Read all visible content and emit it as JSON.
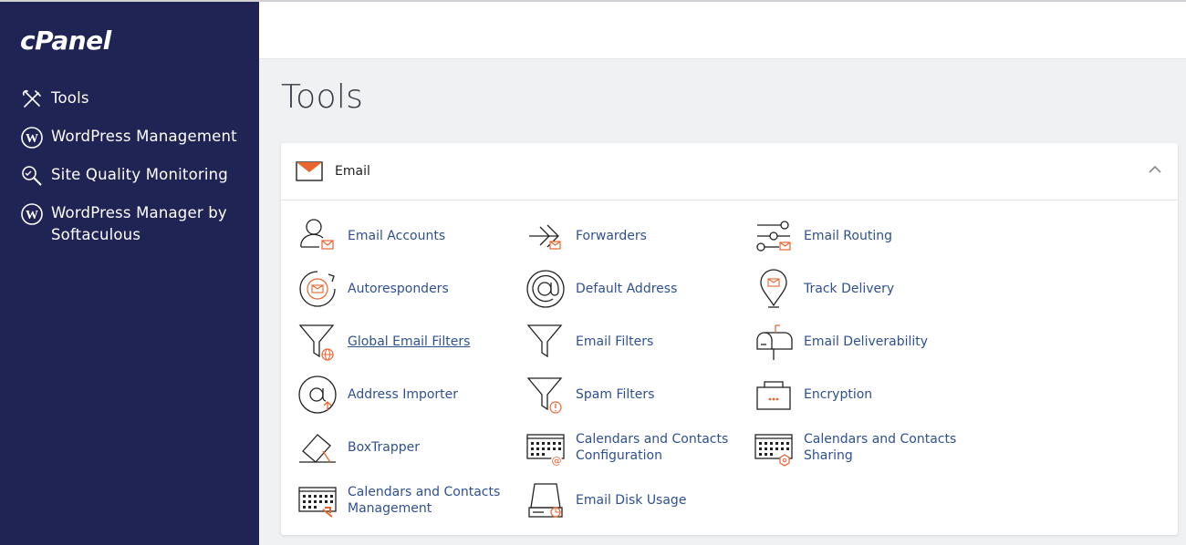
{
  "brand": {
    "logo_text": "cPanel"
  },
  "sidebar": {
    "items": [
      {
        "label": "Tools",
        "icon": "tools-icon"
      },
      {
        "label": "WordPress Management",
        "icon": "wordpress-icon"
      },
      {
        "label": "Site Quality Monitoring",
        "icon": "magnifier-icon"
      },
      {
        "label": "WordPress Manager by Softaculous",
        "icon": "wordpress-icon"
      }
    ]
  },
  "page": {
    "title": "Tools"
  },
  "email_section": {
    "title": "Email",
    "collapsed": false,
    "items": [
      {
        "label": "Email Accounts",
        "icon": "email-accounts-icon"
      },
      {
        "label": "Forwarders",
        "icon": "forwarders-icon"
      },
      {
        "label": "Email Routing",
        "icon": "email-routing-icon"
      },
      {
        "label": "Autoresponders",
        "icon": "autoresponders-icon"
      },
      {
        "label": "Default Address",
        "icon": "at-sign-icon"
      },
      {
        "label": "Track Delivery",
        "icon": "map-pin-icon"
      },
      {
        "label": "Global Email Filters",
        "icon": "global-filter-icon"
      },
      {
        "label": "Email Filters",
        "icon": "filter-icon"
      },
      {
        "label": "Email Deliverability",
        "icon": "mailbox-icon"
      },
      {
        "label": "Address Importer",
        "icon": "address-importer-icon"
      },
      {
        "label": "Spam Filters",
        "icon": "spam-filter-icon"
      },
      {
        "label": "Encryption",
        "icon": "encryption-icon"
      },
      {
        "label": "BoxTrapper",
        "icon": "boxtrapper-icon"
      },
      {
        "label": "Calendars and Contacts Configuration",
        "icon": "calendar-config-icon"
      },
      {
        "label": "Calendars and Contacts Sharing",
        "icon": "calendar-sharing-icon"
      },
      {
        "label": "Calendars and Contacts Management",
        "icon": "calendar-management-icon"
      },
      {
        "label": "Email Disk Usage",
        "icon": "disk-usage-icon"
      }
    ]
  },
  "colors": {
    "sidebar_bg": "#1f2454",
    "link": "#2f5090",
    "accent_orange": "#e8652e"
  }
}
